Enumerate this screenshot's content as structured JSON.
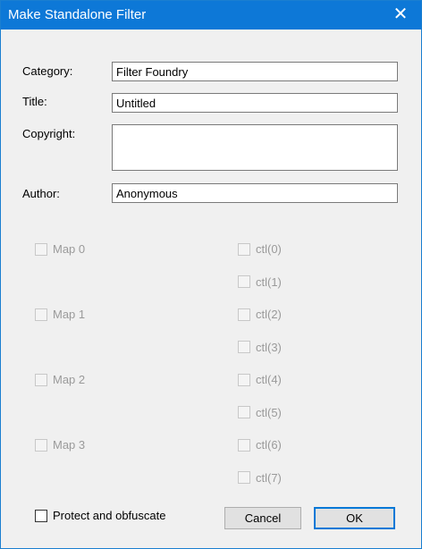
{
  "window": {
    "title": "Make Standalone Filter",
    "close_glyph": "✕"
  },
  "fields": {
    "category": {
      "label": "Category:",
      "value": "Filter Foundry"
    },
    "title": {
      "label": "Title:",
      "value": "Untitled"
    },
    "copyright": {
      "label": "Copyright:",
      "value": ""
    },
    "author": {
      "label": "Author:",
      "value": "Anonymous"
    }
  },
  "maps": [
    {
      "label": "Map 0",
      "checked": false,
      "enabled": false
    },
    {
      "label": "Map 1",
      "checked": false,
      "enabled": false
    },
    {
      "label": "Map 2",
      "checked": false,
      "enabled": false
    },
    {
      "label": "Map 3",
      "checked": false,
      "enabled": false
    }
  ],
  "controls": [
    {
      "label": "ctl(0)",
      "checked": false,
      "enabled": false
    },
    {
      "label": "ctl(1)",
      "checked": false,
      "enabled": false
    },
    {
      "label": "ctl(2)",
      "checked": false,
      "enabled": false
    },
    {
      "label": "ctl(3)",
      "checked": false,
      "enabled": false
    },
    {
      "label": "ctl(4)",
      "checked": false,
      "enabled": false
    },
    {
      "label": "ctl(5)",
      "checked": false,
      "enabled": false
    },
    {
      "label": "ctl(6)",
      "checked": false,
      "enabled": false
    },
    {
      "label": "ctl(7)",
      "checked": false,
      "enabled": false
    }
  ],
  "protect": {
    "label": "Protect and obfuscate",
    "checked": false
  },
  "buttons": {
    "cancel": "Cancel",
    "ok": "OK"
  },
  "colors": {
    "titlebar": "#0d78d7",
    "dialog_bg": "#f0f0f0",
    "disabled_text": "#9a9a9a"
  }
}
